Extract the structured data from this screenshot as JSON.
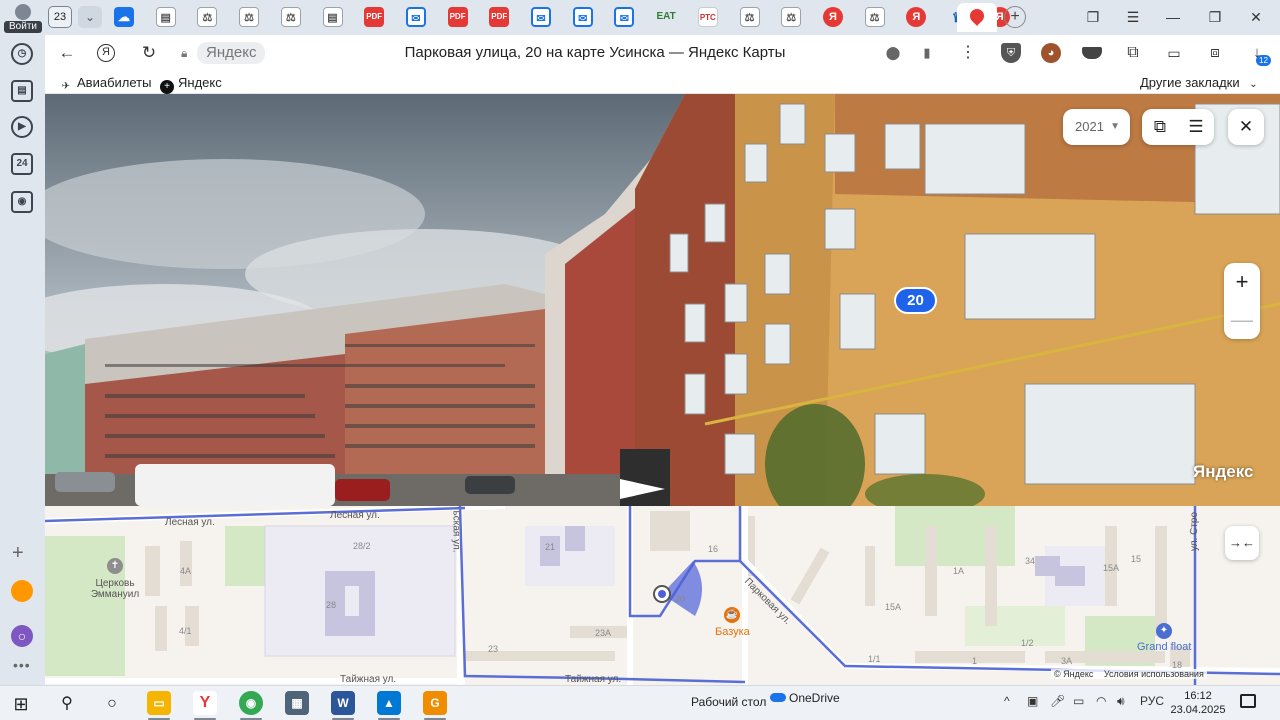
{
  "browser": {
    "profile_label": "Войти",
    "tab_count": "23",
    "bookmarks": [
      {
        "label": "Авиабилеты"
      },
      {
        "label": "Яндекс"
      }
    ],
    "other_bookmarks": "Другие закладки",
    "downloads_badge": "12",
    "url_domain": "Яндекс",
    "page_title": "Парковая улица, 20 на карте Усинска — Яндекс Карты"
  },
  "tabs": [
    {
      "kind": "cloud",
      "icon": "cloud-icon"
    },
    {
      "kind": "doc",
      "icon": "document-icon"
    },
    {
      "kind": "doc",
      "icon": "scales-icon"
    },
    {
      "kind": "doc",
      "icon": "scales-icon"
    },
    {
      "kind": "doc",
      "icon": "scales-icon"
    },
    {
      "kind": "doc",
      "icon": "document-icon"
    },
    {
      "kind": "pdf",
      "label": "PDF"
    },
    {
      "kind": "mail",
      "icon": "mail-icon"
    },
    {
      "kind": "pdf",
      "label": "PDF"
    },
    {
      "kind": "pdf",
      "label": "PDF"
    },
    {
      "kind": "mail",
      "icon": "mail-icon"
    },
    {
      "kind": "mail",
      "icon": "mail-icon"
    },
    {
      "kind": "mail",
      "icon": "mail-icon"
    },
    {
      "kind": "eat",
      "label": "EAT"
    },
    {
      "kind": "rtc",
      "label": "РТС"
    },
    {
      "kind": "doc",
      "icon": "scales-icon"
    },
    {
      "kind": "doc",
      "icon": "scales-icon"
    },
    {
      "kind": "ya",
      "label": "Я"
    },
    {
      "kind": "doc",
      "icon": "scales-icon"
    },
    {
      "kind": "ya",
      "label": "Я"
    },
    {
      "kind": "blue",
      "icon": "emblem-icon"
    },
    {
      "kind": "ya",
      "label": "Я"
    }
  ],
  "panorama": {
    "year": "2021",
    "house_number": "20",
    "watermark": "Яндекс",
    "zoom_in": "+",
    "zoom_out": "—"
  },
  "map": {
    "streets": [
      "Лесная ул.",
      "Лесная ул.",
      "Тайжная ул.",
      "Тайжная ул.",
      "Парковая ул.",
      "ул. Стро",
      "ьская ул."
    ],
    "house_numbers": [
      "28/2",
      "28",
      "4А",
      "4/1",
      "21",
      "16",
      "23А",
      "23",
      "20",
      "15А",
      "1А",
      "1/2",
      "1/1",
      "1",
      "3А",
      "15",
      "15А",
      "34",
      "18"
    ],
    "pois": [
      {
        "name": "Церковь Эммануил"
      },
      {
        "name": "Базука"
      },
      {
        "name": "Grand float"
      }
    ],
    "copyright": "© Яндекс",
    "terms": "Условия использования"
  },
  "taskbar": {
    "apps": [
      "windows-start",
      "search",
      "task-view",
      "file-explorer",
      "yandex-browser",
      "chrome",
      "calculator",
      "word",
      "photos",
      "app-g"
    ],
    "desktop_label": "Рабочий стол",
    "onedrive_label": "OneDrive",
    "lang": "РУС",
    "time": "16:12",
    "date": "23.04.2025"
  },
  "colors": {
    "accent_blue": "#1e63e9",
    "route_blue": "#5b6ed6",
    "tab_red": "#e53935"
  }
}
